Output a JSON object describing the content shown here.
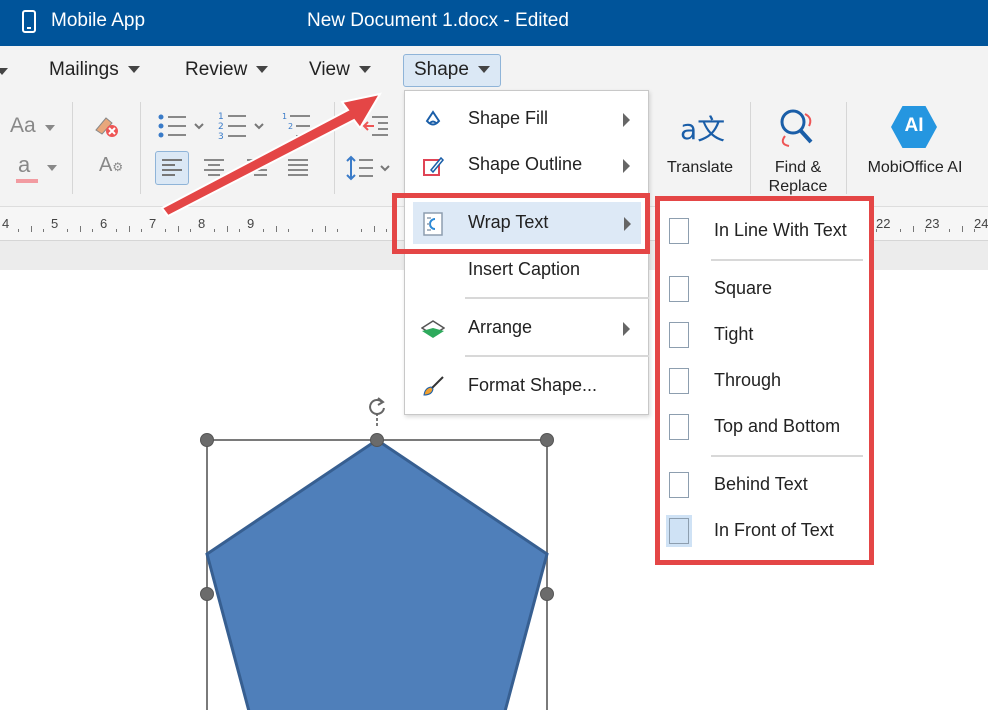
{
  "titlebar": {
    "app_name": "Mobile App",
    "doc_title": "New Document 1.docx - Edited",
    "color": "#00549a"
  },
  "menubar": {
    "items": [
      {
        "label": "Mailings"
      },
      {
        "label": "Review"
      },
      {
        "label": "View"
      },
      {
        "label": "Shape",
        "active": true
      }
    ]
  },
  "ribbon": {
    "font_size_label": "Aa",
    "font_color_label": "a",
    "translate_label": "Translate",
    "find_replace_label": "Find &\nReplace",
    "ai_label": "MobiOffice AI",
    "ai_badge": "AI",
    "translate_glyph": "a文"
  },
  "ruler": {
    "numbers": [
      "4",
      "5",
      "6",
      "7",
      "8",
      "9",
      "22",
      "23",
      "24"
    ]
  },
  "shape_menu": {
    "items": [
      {
        "label": "Shape Fill",
        "icon": "paint-bucket-icon",
        "submenu": true
      },
      {
        "label": "Shape Outline",
        "icon": "pen-outline-icon",
        "submenu": true
      },
      {
        "label": "Wrap Text",
        "icon": "wrap-text-icon",
        "submenu": true,
        "highlighted": true
      },
      {
        "label": "Insert Caption",
        "icon": "",
        "submenu": false
      },
      {
        "label": "Arrange",
        "icon": "layers-icon",
        "submenu": true
      },
      {
        "label": "Format Shape...",
        "icon": "brush-icon",
        "submenu": false
      }
    ]
  },
  "wrap_submenu": {
    "items": [
      {
        "label": "In Line With Text"
      },
      {
        "label": "Square"
      },
      {
        "label": "Tight"
      },
      {
        "label": "Through"
      },
      {
        "label": "Top and Bottom"
      },
      {
        "label": "Behind Text"
      },
      {
        "label": "In Front of Text",
        "selected": true
      }
    ]
  },
  "colors": {
    "accent": "#00549a",
    "highlight_box": "#e44646",
    "shape_fill": "#4f7fba",
    "shape_stroke": "#375f91"
  }
}
